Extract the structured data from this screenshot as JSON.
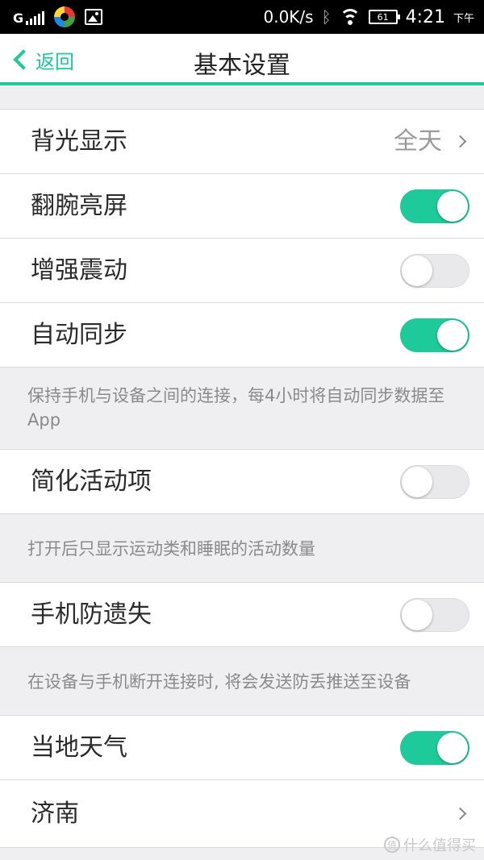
{
  "status_bar": {
    "signal_label": "G",
    "network_speed": "0.0K/s",
    "bluetooth_icon": "bluetooth-icon",
    "battery_level": "61",
    "time": "4:21",
    "am_pm": "下午"
  },
  "nav": {
    "back_label": "返回",
    "title": "基本设置"
  },
  "settings": {
    "backlight": {
      "label": "背光显示",
      "value": "全天"
    },
    "wrist_wake": {
      "label": "翻腕亮屏",
      "on": true
    },
    "enhanced_vibration": {
      "label": "增强震动",
      "on": false
    },
    "auto_sync": {
      "label": "自动同步",
      "on": true,
      "note": "保持手机与设备之间的连接，每4小时将自动同步数据至App"
    },
    "simplify_activity": {
      "label": "简化活动项",
      "on": false,
      "note": "打开后只显示运动类和睡眠的活动数量"
    },
    "phone_anti_loss": {
      "label": "手机防遗失",
      "on": false,
      "note": "在设备与手机断开连接时, 将会发送防丢推送至设备"
    },
    "local_weather": {
      "label": "当地天气",
      "on": true
    },
    "city": {
      "label": "济南"
    }
  },
  "watermark": {
    "text": "什么值得买",
    "logo": "值"
  },
  "colors": {
    "accent": "#1ec99a",
    "toggle_off": "#e9e9eb",
    "background": "#efeff1"
  }
}
